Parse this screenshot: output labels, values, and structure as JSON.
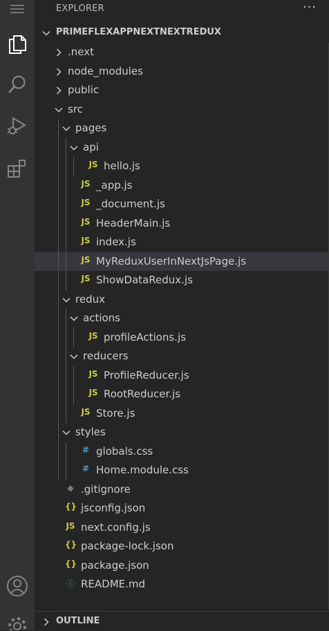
{
  "explorer": {
    "title": "EXPLORER",
    "more_actions": "···",
    "root_folder": "PRIMEFLEXAPPNEXTNEXTREDUX"
  },
  "tree": [
    {
      "label": ".next",
      "type": "folder",
      "expanded": false,
      "depth": 0
    },
    {
      "label": "node_modules",
      "type": "folder",
      "expanded": false,
      "depth": 0
    },
    {
      "label": "public",
      "type": "folder",
      "expanded": false,
      "depth": 0
    },
    {
      "label": "src",
      "type": "folder",
      "expanded": true,
      "depth": 0
    },
    {
      "label": "pages",
      "type": "folder",
      "expanded": true,
      "depth": 1
    },
    {
      "label": "api",
      "type": "folder",
      "expanded": true,
      "depth": 2
    },
    {
      "label": "hello.js",
      "type": "js",
      "icon_text": "JS",
      "depth": 3
    },
    {
      "label": "_app.js",
      "type": "js",
      "icon_text": "JS",
      "depth": 2
    },
    {
      "label": "_document.js",
      "type": "js",
      "icon_text": "JS",
      "depth": 2
    },
    {
      "label": "HeaderMain.js",
      "type": "js",
      "icon_text": "JS",
      "depth": 2
    },
    {
      "label": "index.js",
      "type": "js",
      "icon_text": "JS",
      "depth": 2
    },
    {
      "label": "MyReduxUserInNextJsPage.js",
      "type": "js",
      "icon_text": "JS",
      "depth": 2,
      "selected": true
    },
    {
      "label": "ShowDataRedux.js",
      "type": "js",
      "icon_text": "JS",
      "depth": 2
    },
    {
      "label": "redux",
      "type": "folder",
      "expanded": true,
      "depth": 1
    },
    {
      "label": "actions",
      "type": "folder",
      "expanded": true,
      "depth": 2
    },
    {
      "label": "profileActions.js",
      "type": "js",
      "icon_text": "JS",
      "depth": 3
    },
    {
      "label": "reducers",
      "type": "folder",
      "expanded": true,
      "depth": 2
    },
    {
      "label": "ProfileReducer.js",
      "type": "js",
      "icon_text": "JS",
      "depth": 3
    },
    {
      "label": "RootReducer.js",
      "type": "js",
      "icon_text": "JS",
      "depth": 3
    },
    {
      "label": "Store.js",
      "type": "js",
      "icon_text": "JS",
      "depth": 2
    },
    {
      "label": "styles",
      "type": "folder",
      "expanded": true,
      "depth": 1
    },
    {
      "label": "globals.css",
      "type": "css",
      "icon_text": "#",
      "depth": 2
    },
    {
      "label": "Home.module.css",
      "type": "css",
      "icon_text": "#",
      "depth": 2
    },
    {
      "label": ".gitignore",
      "type": "git",
      "icon_text": "◆",
      "depth": 0
    },
    {
      "label": "jsconfig.json",
      "type": "json",
      "icon_text": "{}",
      "depth": 0
    },
    {
      "label": "next.config.js",
      "type": "js",
      "icon_text": "JS",
      "depth": 0
    },
    {
      "label": "package-lock.json",
      "type": "json",
      "icon_text": "{}",
      "depth": 0
    },
    {
      "label": "package.json",
      "type": "json",
      "icon_text": "{}",
      "depth": 0
    },
    {
      "label": "README.md",
      "type": "info",
      "icon_text": "ⓘ",
      "depth": 0
    }
  ],
  "outline": {
    "title": "OUTLINE"
  },
  "activity_bar": [
    {
      "name": "menu-icon"
    },
    {
      "name": "files-icon",
      "active": true
    },
    {
      "name": "search-icon"
    },
    {
      "name": "run-debug-icon"
    },
    {
      "name": "extensions-icon"
    },
    {
      "name": "account-icon"
    },
    {
      "name": "settings-gear-icon"
    }
  ],
  "colors": {
    "activity_bar_bg": "#333333",
    "sidebar_bg": "#252526",
    "selected_row_bg": "#37373d",
    "js_icon": "#cbcb41",
    "css_icon": "#519aba",
    "text": "#cccccc"
  }
}
